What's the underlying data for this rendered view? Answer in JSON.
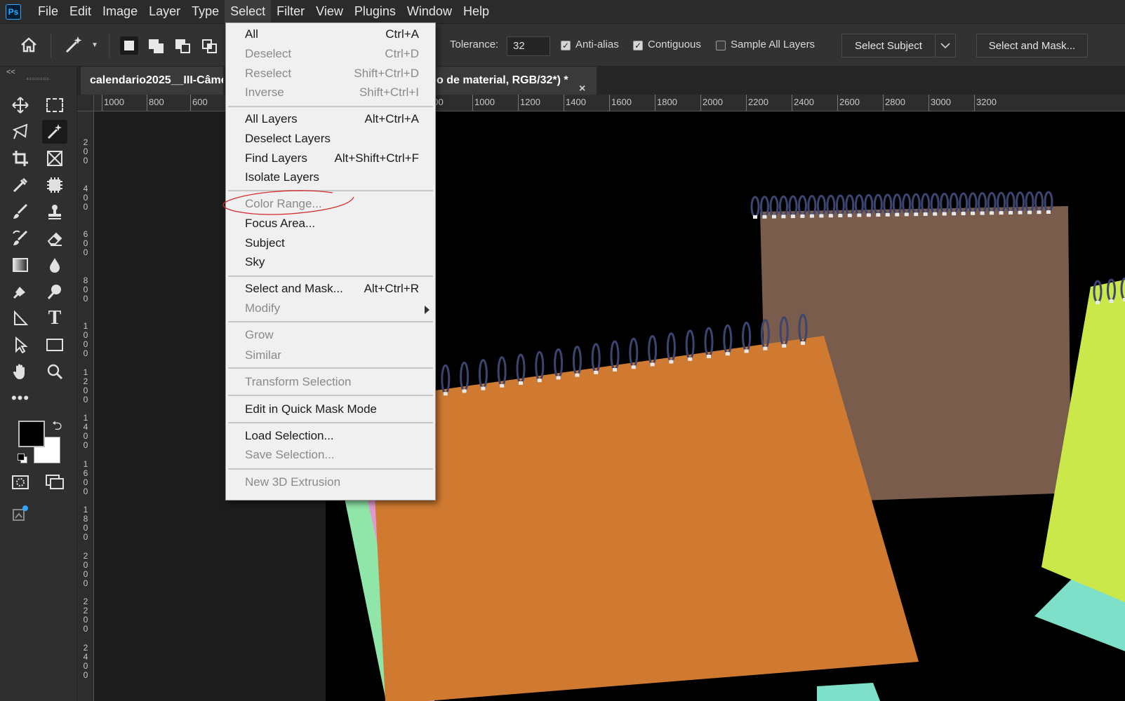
{
  "app": {
    "logo": "Ps"
  },
  "menubar": {
    "items": [
      "File",
      "Edit",
      "Image",
      "Layer",
      "Type",
      "Select",
      "Filter",
      "View",
      "Plugins",
      "Window",
      "Help"
    ]
  },
  "options": {
    "tolerance_label": "Tolerance:",
    "tolerance_value": "32",
    "antialias_label": "Anti-alias",
    "contiguous_label": "Contiguous",
    "sample_all_label": "Sample All Layers",
    "select_subject_label": "Select Subject",
    "select_mask_label": "Select and Mask..."
  },
  "tabs": {
    "doc1": "calendario2025__III-Câme",
    "doc2": "o de material, RGB/32*) *",
    "close": "×",
    "collapse": "<<"
  },
  "ruler": {
    "top": [
      "1000",
      "800",
      "600",
      "00",
      "600",
      "800",
      "1000",
      "1200",
      "1400",
      "1600",
      "1800",
      "2000",
      "2200",
      "2400",
      "2600",
      "2800",
      "3000",
      "3200"
    ],
    "left": [
      "200",
      "400",
      "600",
      "800",
      "1000",
      "1200",
      "1400",
      "1600",
      "1800",
      "2000",
      "2200",
      "2400"
    ]
  },
  "select_menu": {
    "items": [
      {
        "label": "All",
        "shortcut": "Ctrl+A",
        "disabled": false
      },
      {
        "label": "Deselect",
        "shortcut": "Ctrl+D",
        "disabled": true
      },
      {
        "label": "Reselect",
        "shortcut": "Shift+Ctrl+D",
        "disabled": true
      },
      {
        "label": "Inverse",
        "shortcut": "Shift+Ctrl+I",
        "disabled": true
      },
      {
        "label": "All Layers",
        "shortcut": "Alt+Ctrl+A",
        "disabled": false
      },
      {
        "label": "Deselect Layers",
        "shortcut": "",
        "disabled": false
      },
      {
        "label": "Find Layers",
        "shortcut": "Alt+Shift+Ctrl+F",
        "disabled": false
      },
      {
        "label": "Isolate Layers",
        "shortcut": "",
        "disabled": false
      },
      {
        "label": "Color Range...",
        "shortcut": "",
        "disabled": true
      },
      {
        "label": "Focus Area...",
        "shortcut": "",
        "disabled": false
      },
      {
        "label": "Subject",
        "shortcut": "",
        "disabled": false
      },
      {
        "label": "Sky",
        "shortcut": "",
        "disabled": false
      },
      {
        "label": "Select and Mask...",
        "shortcut": "Alt+Ctrl+R",
        "disabled": false
      },
      {
        "label": "Modify",
        "shortcut": "",
        "disabled": true
      },
      {
        "label": "Grow",
        "shortcut": "",
        "disabled": true
      },
      {
        "label": "Similar",
        "shortcut": "",
        "disabled": true
      },
      {
        "label": "Transform Selection",
        "shortcut": "",
        "disabled": true
      },
      {
        "label": "Edit in Quick Mask Mode",
        "shortcut": "",
        "disabled": false
      },
      {
        "label": "Load Selection...",
        "shortcut": "",
        "disabled": false
      },
      {
        "label": "Save Selection...",
        "shortcut": "",
        "disabled": true
      },
      {
        "label": "New 3D Extrusion",
        "shortcut": "",
        "disabled": true
      }
    ]
  },
  "colors": {
    "accent": "#31a8ff",
    "annotation": "#d42b2b",
    "notebook_brown": "#7a5c4c",
    "notebook_orange": "#cf7a30",
    "notebook_lime": "#cbe84a",
    "notebook_teal": "#7ee0c8",
    "notebook_pink": "#e09ad0",
    "notebook_green": "#8fe6a8",
    "spiral": "#3c4570"
  }
}
